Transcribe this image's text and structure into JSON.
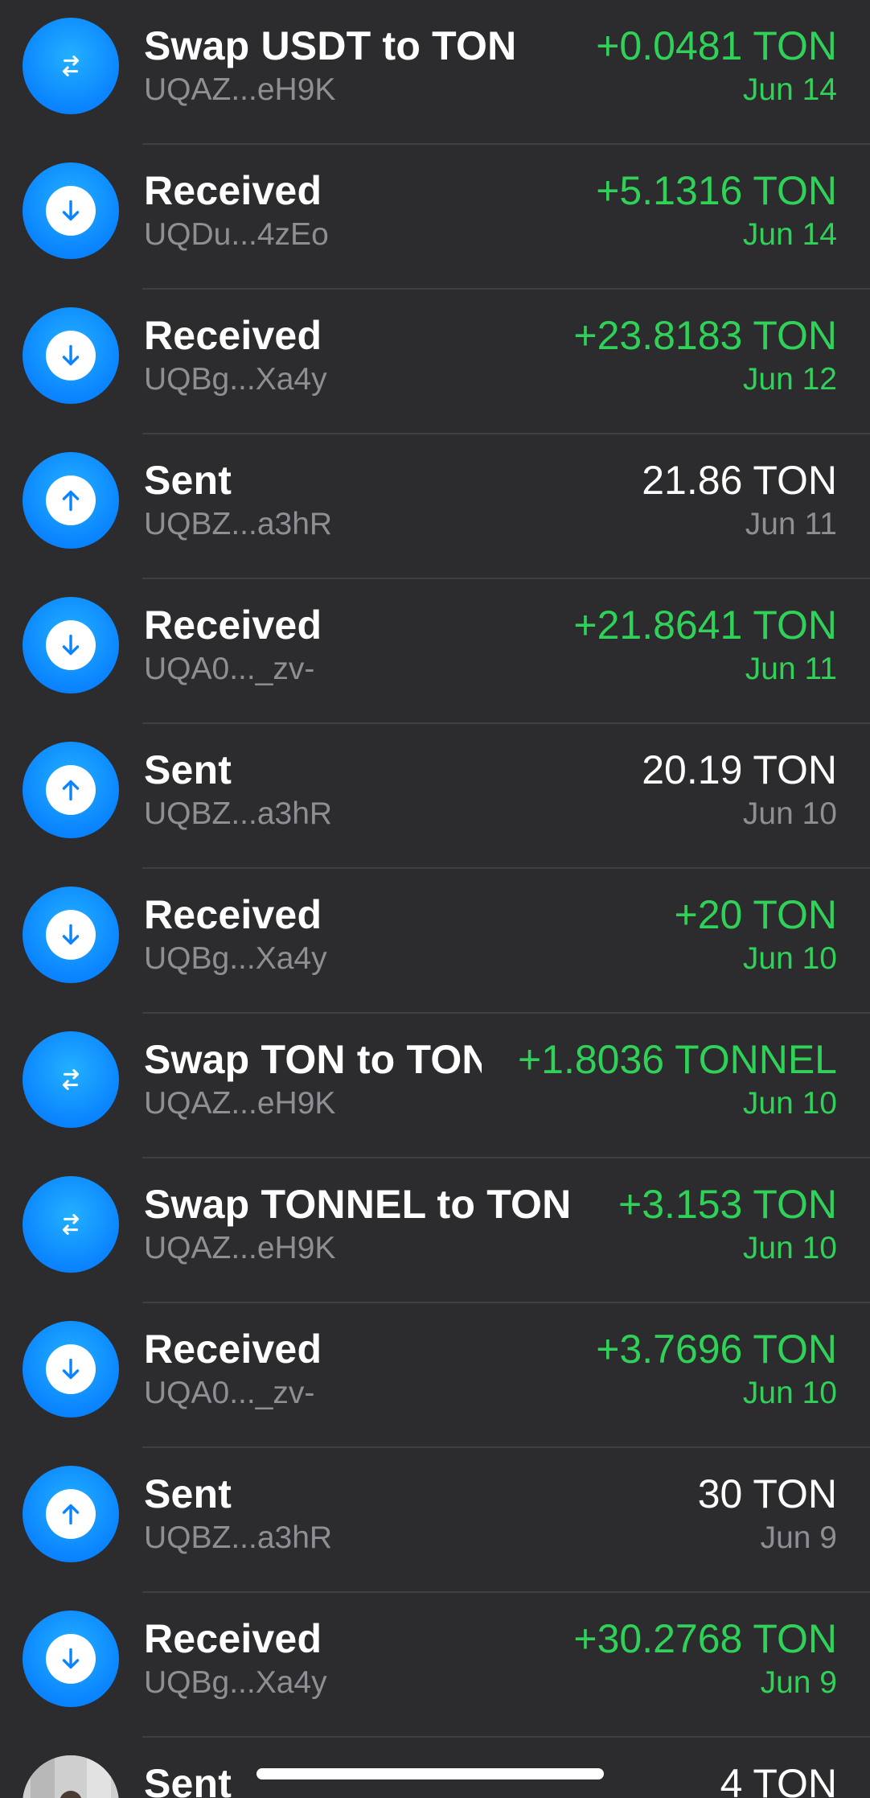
{
  "transactions": [
    {
      "type": "swap",
      "title": "Swap USDT to TON",
      "address": "UQAZ...eH9K",
      "amount": "+0.0481 TON",
      "date": "Jun 14",
      "positive": true
    },
    {
      "type": "received",
      "title": "Received",
      "address": "UQDu...4zEo",
      "amount": "+5.1316 TON",
      "date": "Jun 14",
      "positive": true
    },
    {
      "type": "received",
      "title": "Received",
      "address": "UQBg...Xa4y",
      "amount": "+23.8183 TON",
      "date": "Jun 12",
      "positive": true
    },
    {
      "type": "sent",
      "title": "Sent",
      "address": "UQBZ...a3hR",
      "amount": "21.86 TON",
      "date": "Jun 11",
      "positive": false
    },
    {
      "type": "received",
      "title": "Received",
      "address": "UQA0..._zv-",
      "amount": "+21.8641 TON",
      "date": "Jun 11",
      "positive": true
    },
    {
      "type": "sent",
      "title": "Sent",
      "address": "UQBZ...a3hR",
      "amount": "20.19 TON",
      "date": "Jun 10",
      "positive": false
    },
    {
      "type": "received",
      "title": "Received",
      "address": "UQBg...Xa4y",
      "amount": "+20 TON",
      "date": "Jun 10",
      "positive": true
    },
    {
      "type": "swap",
      "title": "Swap TON to TONNEL",
      "address": "UQAZ...eH9K",
      "amount": "+1.8036 TONNEL",
      "date": "Jun 10",
      "positive": true
    },
    {
      "type": "swap",
      "title": "Swap TONNEL to TON",
      "address": "UQAZ...eH9K",
      "amount": "+3.153 TON",
      "date": "Jun 10",
      "positive": true
    },
    {
      "type": "received",
      "title": "Received",
      "address": "UQA0..._zv-",
      "amount": "+3.7696 TON",
      "date": "Jun 10",
      "positive": true
    },
    {
      "type": "sent",
      "title": "Sent",
      "address": "UQBZ...a3hR",
      "amount": "30 TON",
      "date": "Jun 9",
      "positive": false
    },
    {
      "type": "received",
      "title": "Received",
      "address": "UQBg...Xa4y",
      "amount": "+30.2768 TON",
      "date": "Jun 9",
      "positive": true
    },
    {
      "type": "sent",
      "title": "Sent",
      "address": "",
      "amount": "4 TON",
      "date": "",
      "positive": false,
      "avatar": true
    }
  ],
  "icons": {
    "swap": "swap-arrows-icon",
    "received": "arrow-down-icon",
    "sent": "arrow-up-icon"
  },
  "colors": {
    "background": "#2c2c2e",
    "accent": "#0a84ff",
    "positive": "#30d158",
    "secondary_text": "#8e8e93"
  }
}
